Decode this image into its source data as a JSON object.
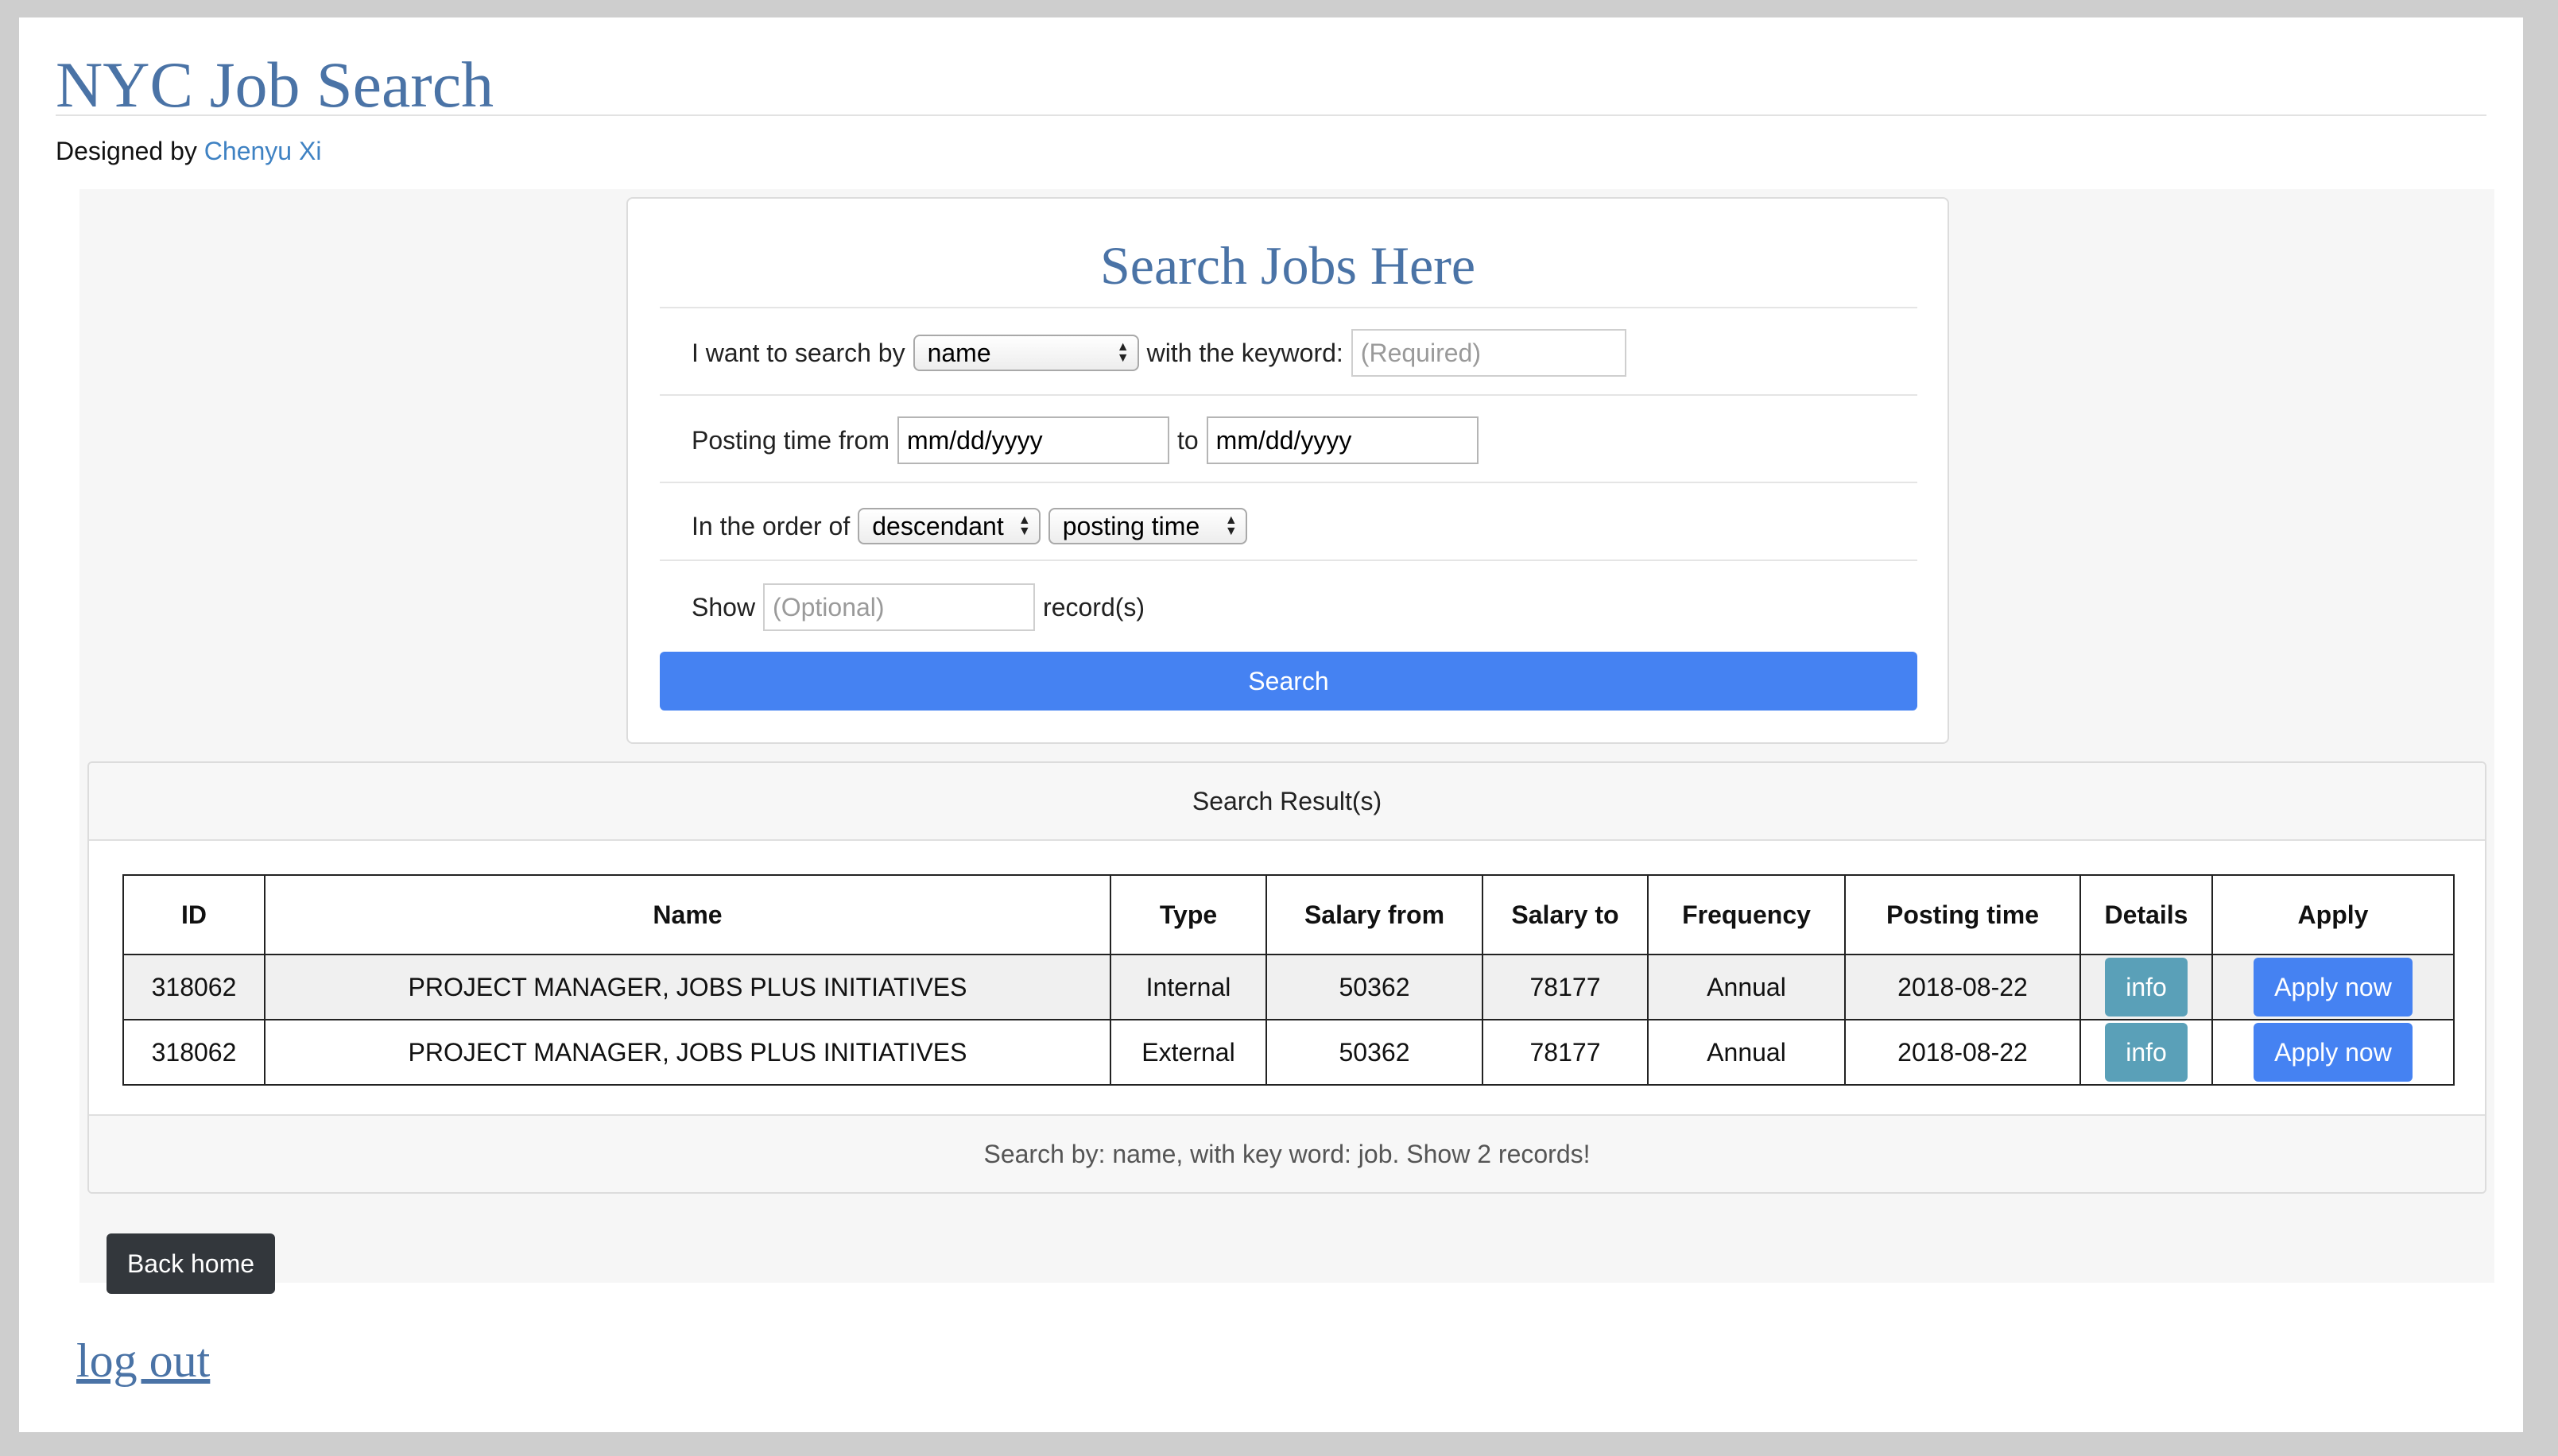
{
  "header": {
    "title": "NYC Job Search",
    "designed_by_label": "Designed by",
    "designer_name": "Chenyu Xi"
  },
  "search_form": {
    "heading": "Search Jobs Here",
    "search_by_label": "I want to search by",
    "search_by_value": "name",
    "keyword_label": "with the keyword:",
    "keyword_placeholder": "(Required)",
    "posting_from_label": "Posting time from",
    "date_from_value": "mm/dd/yyyy",
    "to_label": "to",
    "date_to_value": "mm/dd/yyyy",
    "order_label": "In the order of",
    "order_direction_value": "descendant",
    "order_field_value": "posting time",
    "show_label": "Show",
    "show_placeholder": "(Optional)",
    "records_label": "record(s)",
    "search_button": "Search"
  },
  "results": {
    "heading": "Search Result(s)",
    "columns": [
      "ID",
      "Name",
      "Type",
      "Salary from",
      "Salary to",
      "Frequency",
      "Posting time",
      "Details",
      "Apply"
    ],
    "rows": [
      {
        "id": "318062",
        "name": "PROJECT MANAGER, JOBS PLUS INITIATIVES",
        "type": "Internal",
        "salary_from": "50362",
        "salary_to": "78177",
        "frequency": "Annual",
        "posting_time": "2018-08-22",
        "details_button": "info",
        "apply_button": "Apply now"
      },
      {
        "id": "318062",
        "name": "PROJECT MANAGER, JOBS PLUS INITIATIVES",
        "type": "External",
        "salary_from": "50362",
        "salary_to": "78177",
        "frequency": "Annual",
        "posting_time": "2018-08-22",
        "details_button": "info",
        "apply_button": "Apply now"
      }
    ],
    "summary": "Search by: name, with key word: job. Show 2 records!"
  },
  "back_home_button": "Back home",
  "logout_link": "log out",
  "colors": {
    "title_blue": "#4a73a6",
    "primary_button": "#4582f2",
    "info_button": "#5aa0b8",
    "dark_button": "#33373c",
    "link_blue": "#3f82c3"
  }
}
